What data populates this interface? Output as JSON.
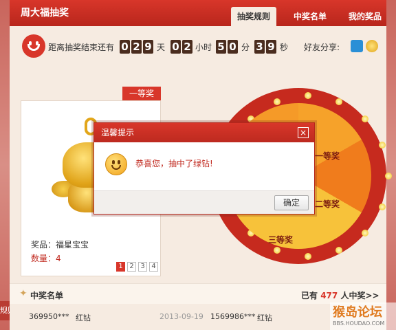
{
  "header": {
    "title": "周大福抽奖",
    "tabs": [
      "抽奖规则",
      "中奖名单",
      "我的奖品"
    ]
  },
  "countdown": {
    "label": "距离抽奖结束还有",
    "days": [
      "0",
      "2",
      "9"
    ],
    "days_unit": "天",
    "hours": [
      "0",
      "2"
    ],
    "hours_unit": "小时",
    "minutes": [
      "5",
      "0"
    ],
    "minutes_unit": "分",
    "seconds": [
      "3",
      "9"
    ],
    "seconds_unit": "秒"
  },
  "share": {
    "label": "好友分享:"
  },
  "left_tag": "规则",
  "prize": {
    "tag": "一等奖",
    "name": "奖品：福星宝宝",
    "quantity": "数量：4",
    "pages": [
      "1",
      "2",
      "3",
      "4"
    ]
  },
  "wheel": {
    "labels": [
      "一等奖",
      "二等奖",
      "三等奖"
    ]
  },
  "dialog": {
    "title": "温馨提示",
    "close": "×",
    "message": "恭喜您，抽中了绿钻!",
    "ok_label": "确定"
  },
  "winners": {
    "title": "中奖名单",
    "count_prefix": "已有",
    "count": "477",
    "count_suffix": "人中奖>>",
    "rows": [
      {
        "user": "369950***",
        "prize": "红钻",
        "date": "2013-09-19"
      },
      {
        "user": "1569986***",
        "prize": "红钻"
      }
    ]
  },
  "watermark": {
    "main": "猴岛论坛",
    "sub": "BBS.HOUDAO.COM"
  },
  "colors": {
    "brand": "#d8362a",
    "digit_bg": "#4a2c1e",
    "gold": "#e2a61a"
  }
}
